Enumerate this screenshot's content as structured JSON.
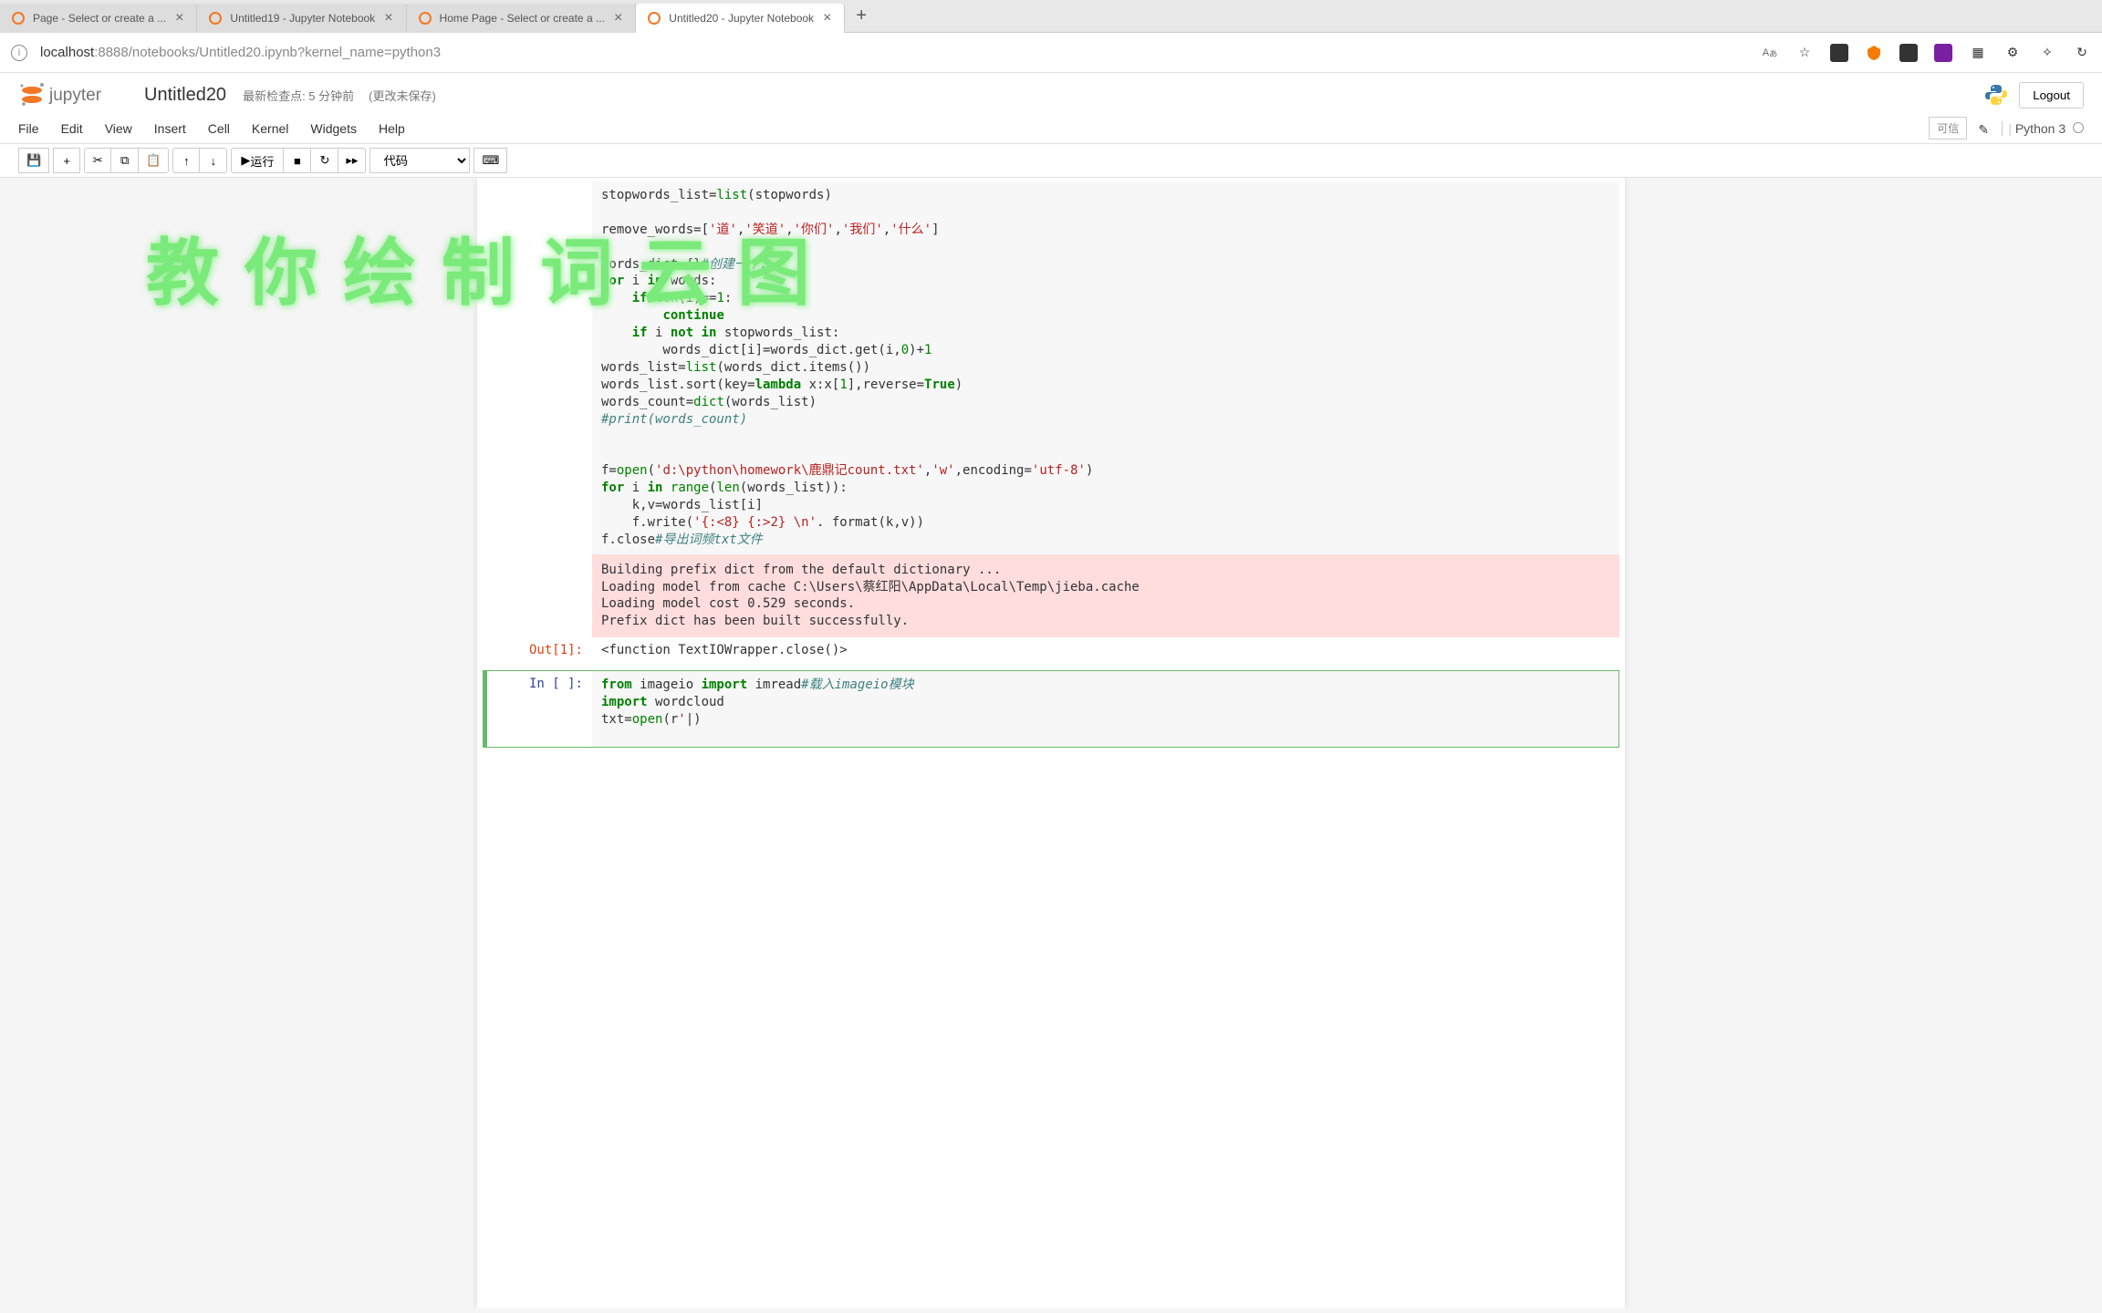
{
  "browser": {
    "tabs": [
      {
        "title": "Page - Select or create a ..."
      },
      {
        "title": "Untitled19 - Jupyter Notebook"
      },
      {
        "title": "Home Page - Select or create a ..."
      },
      {
        "title": "Untitled20 - Jupyter Notebook"
      }
    ],
    "url_host": "localhost",
    "url_port": ":8888",
    "url_path": "/notebooks/Untitled20.ipynb?kernel_name=python3"
  },
  "jupyter": {
    "brand": "jupyter",
    "title": "Untitled20",
    "checkpoint": "最新检查点: 5 分钟前",
    "unsaved": "(更改未保存)",
    "logout": "Logout",
    "menus": [
      "File",
      "Edit",
      "View",
      "Insert",
      "Cell",
      "Kernel",
      "Widgets",
      "Help"
    ],
    "trusted": "可信",
    "kernel": "Python 3",
    "run_label": "运行",
    "cell_type": "代码"
  },
  "notebook": {
    "code1_html": "stopwords_list=<span class='builtin'>list</span>(stopwords)\n\nremove_words=[<span class='str'>'道'</span>,<span class='str'>'笑道'</span>,<span class='str'>'你们'</span>,<span class='str'>'我们'</span>,<span class='str'>'什么'</span>]\n\nwords_dict={}<span class='com'>#创建一个...</span>\n<span class='kw'>for</span> i <span class='kw'>in</span> words:\n    <span class='kw'>if</span> <span class='builtin'>len</span>(i)==<span class='num'>1</span>:\n        <span class='kw'>continue</span>\n    <span class='kw'>if</span> i <span class='kw'>not in</span> stopwords_list:\n        words_dict[i]=words_dict.get(i,<span class='num'>0</span>)+<span class='num'>1</span>\nwords_list=<span class='builtin'>list</span>(words_dict.items())\nwords_list.sort(key=<span class='kw'>lambda</span> x:x[<span class='num'>1</span>],reverse=<span class='boolean'>True</span>)\nwords_count=<span class='builtin'>dict</span>(words_list)\n<span class='com'>#print(words_count)</span>\n\n\nf=<span class='builtin'>open</span>(<span class='str'>'d:\\python\\homework\\鹿鼎记count.txt'</span>,<span class='str'>'w'</span>,encoding=<span class='str'>'utf-8'</span>)\n<span class='kw'>for</span> i <span class='kw'>in</span> <span class='builtin'>range</span>(<span class='builtin'>len</span>(words_list)):\n    k,v=words_list[i]\n    f.write(<span class='str'>'{:&lt;8} {:&gt;2} \\n'</span>. format(k,v))\nf.close<span class='com'>#导出词频txt文件</span>",
    "stderr": "Building prefix dict from the default dictionary ...\nLoading model from cache C:\\Users\\蔡红阳\\AppData\\Local\\Temp\\jieba.cache\nLoading model cost 0.529 seconds.\nPrefix dict has been built successfully.",
    "out1_prompt": "Out[1]:",
    "out1_text": "<function TextIOWrapper.close()>",
    "in2_prompt": "In [ ]:",
    "code2_html": "<span class='kw'>from</span> imageio <span class='kw'>import</span> imread<span class='com'>#载入imageio模块</span>\n<span class='kw'>import</span> wordcloud\ntxt=<span class='builtin'>open</span>(r<span class='str'>'</span>|)"
  },
  "overlay": "教你绘制词云图"
}
